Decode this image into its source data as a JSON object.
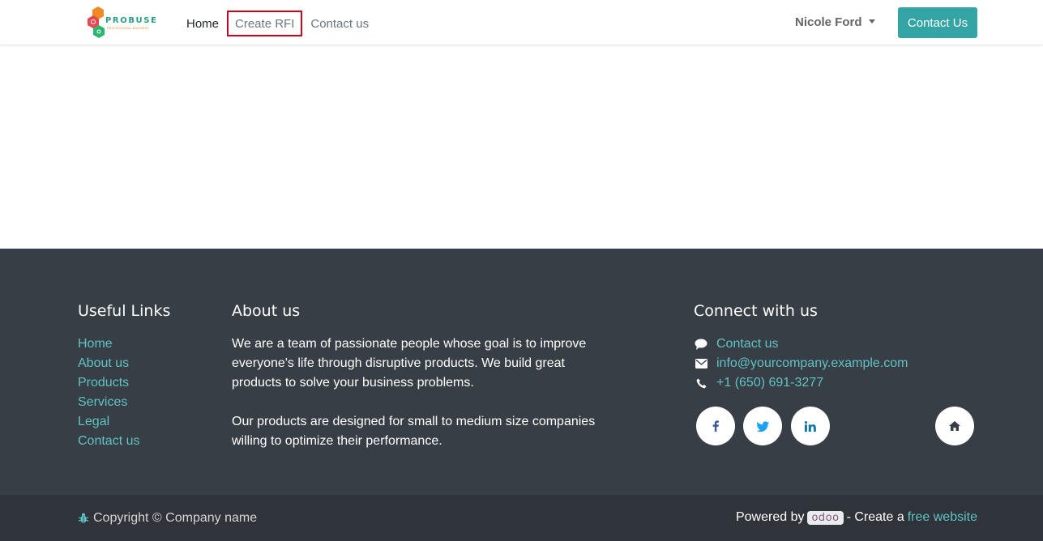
{
  "header": {
    "logo_text": "PROBUSE",
    "logo_tagline": "PROFESSIONAL BUSINESS",
    "nav": [
      {
        "label": "Home"
      },
      {
        "label": "Create RFI"
      },
      {
        "label": "Contact us"
      }
    ],
    "user_name": "Nicole Ford",
    "cta_label": "Contact Us"
  },
  "footer": {
    "useful_links": {
      "title": "Useful Links",
      "items": [
        "Home",
        "About us",
        "Products",
        "Services",
        "Legal",
        "Contact us"
      ]
    },
    "about": {
      "title": "About us",
      "paragraph1": "We are a team of passionate people whose goal is to improve everyone's life through disruptive products. We build great products to solve your business problems.",
      "paragraph2": "Our products are designed for small to medium size companies willing to optimize their performance."
    },
    "connect": {
      "title": "Connect with us",
      "items": [
        {
          "icon": "comment-icon",
          "label": "Contact us"
        },
        {
          "icon": "envelope-icon",
          "label": "info@yourcompany.example.com"
        },
        {
          "icon": "phone-icon",
          "label": "+1 (650) 691-3277"
        }
      ],
      "social": [
        "facebook-icon",
        "twitter-icon",
        "linkedin-icon",
        "home-icon"
      ]
    }
  },
  "copyright": {
    "text": "Copyright © Company name",
    "powered_by": "Powered by",
    "odoo": "odoo",
    "create_a": "- Create a",
    "free_website": "free website"
  },
  "colors": {
    "accent": "#35a4a4",
    "link": "#5fc3c5",
    "footer_bg": "#383e45",
    "copyright_bg": "#2f343a",
    "highlight_border": "#d0021b"
  }
}
